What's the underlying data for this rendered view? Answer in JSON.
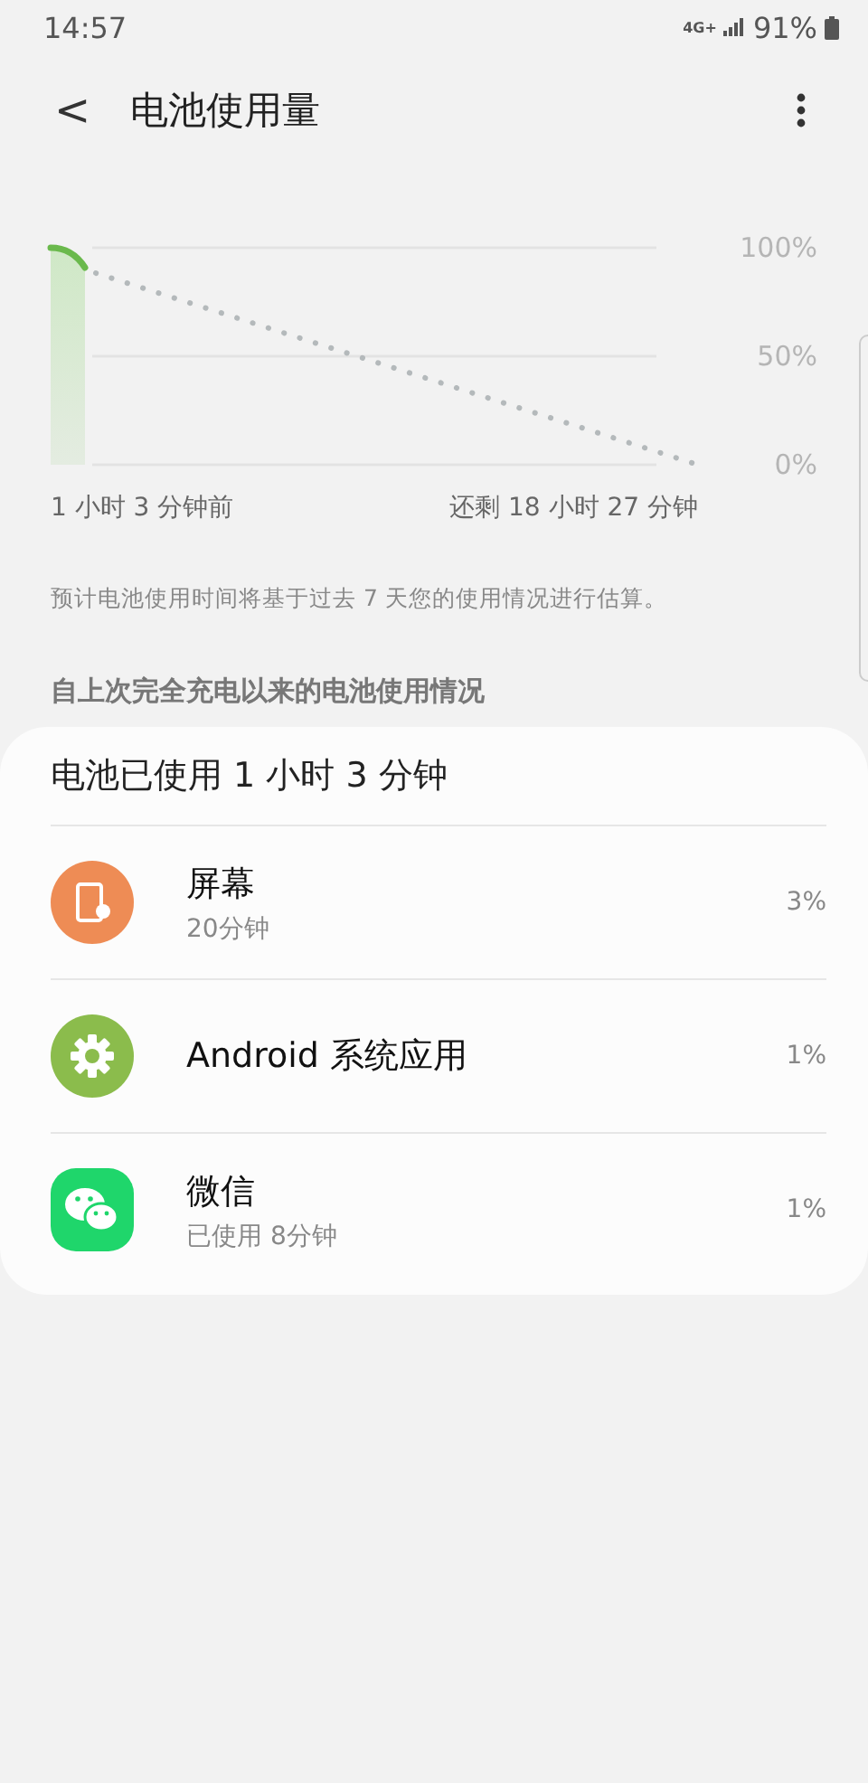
{
  "status_bar": {
    "time": "14:57",
    "network": "4G+",
    "battery": "91%"
  },
  "app_bar": {
    "back": "<",
    "title": "电池使用量"
  },
  "chart": {
    "y_labels": [
      "100%",
      "50%",
      "0%"
    ],
    "x_labels": [
      "1 小时 3 分钟前",
      "还剩 18 小时 27 分钟"
    ]
  },
  "note": "预计电池使用时间将基于过去 7 天您的使用情况进行估算。",
  "section_title": "自上次完全充电以来的电池使用情况",
  "usage": {
    "title": "电池已使用 1 小时 3 分钟",
    "items": [
      {
        "kind": "screen",
        "name": "屏幕",
        "detail": "20分钟",
        "percent": "3%"
      },
      {
        "kind": "system",
        "name": "Android 系统应用",
        "percent": "1%"
      },
      {
        "kind": "wechat",
        "name": "微信",
        "detail": "已使用 8分钟",
        "percent": "1%"
      }
    ]
  }
}
